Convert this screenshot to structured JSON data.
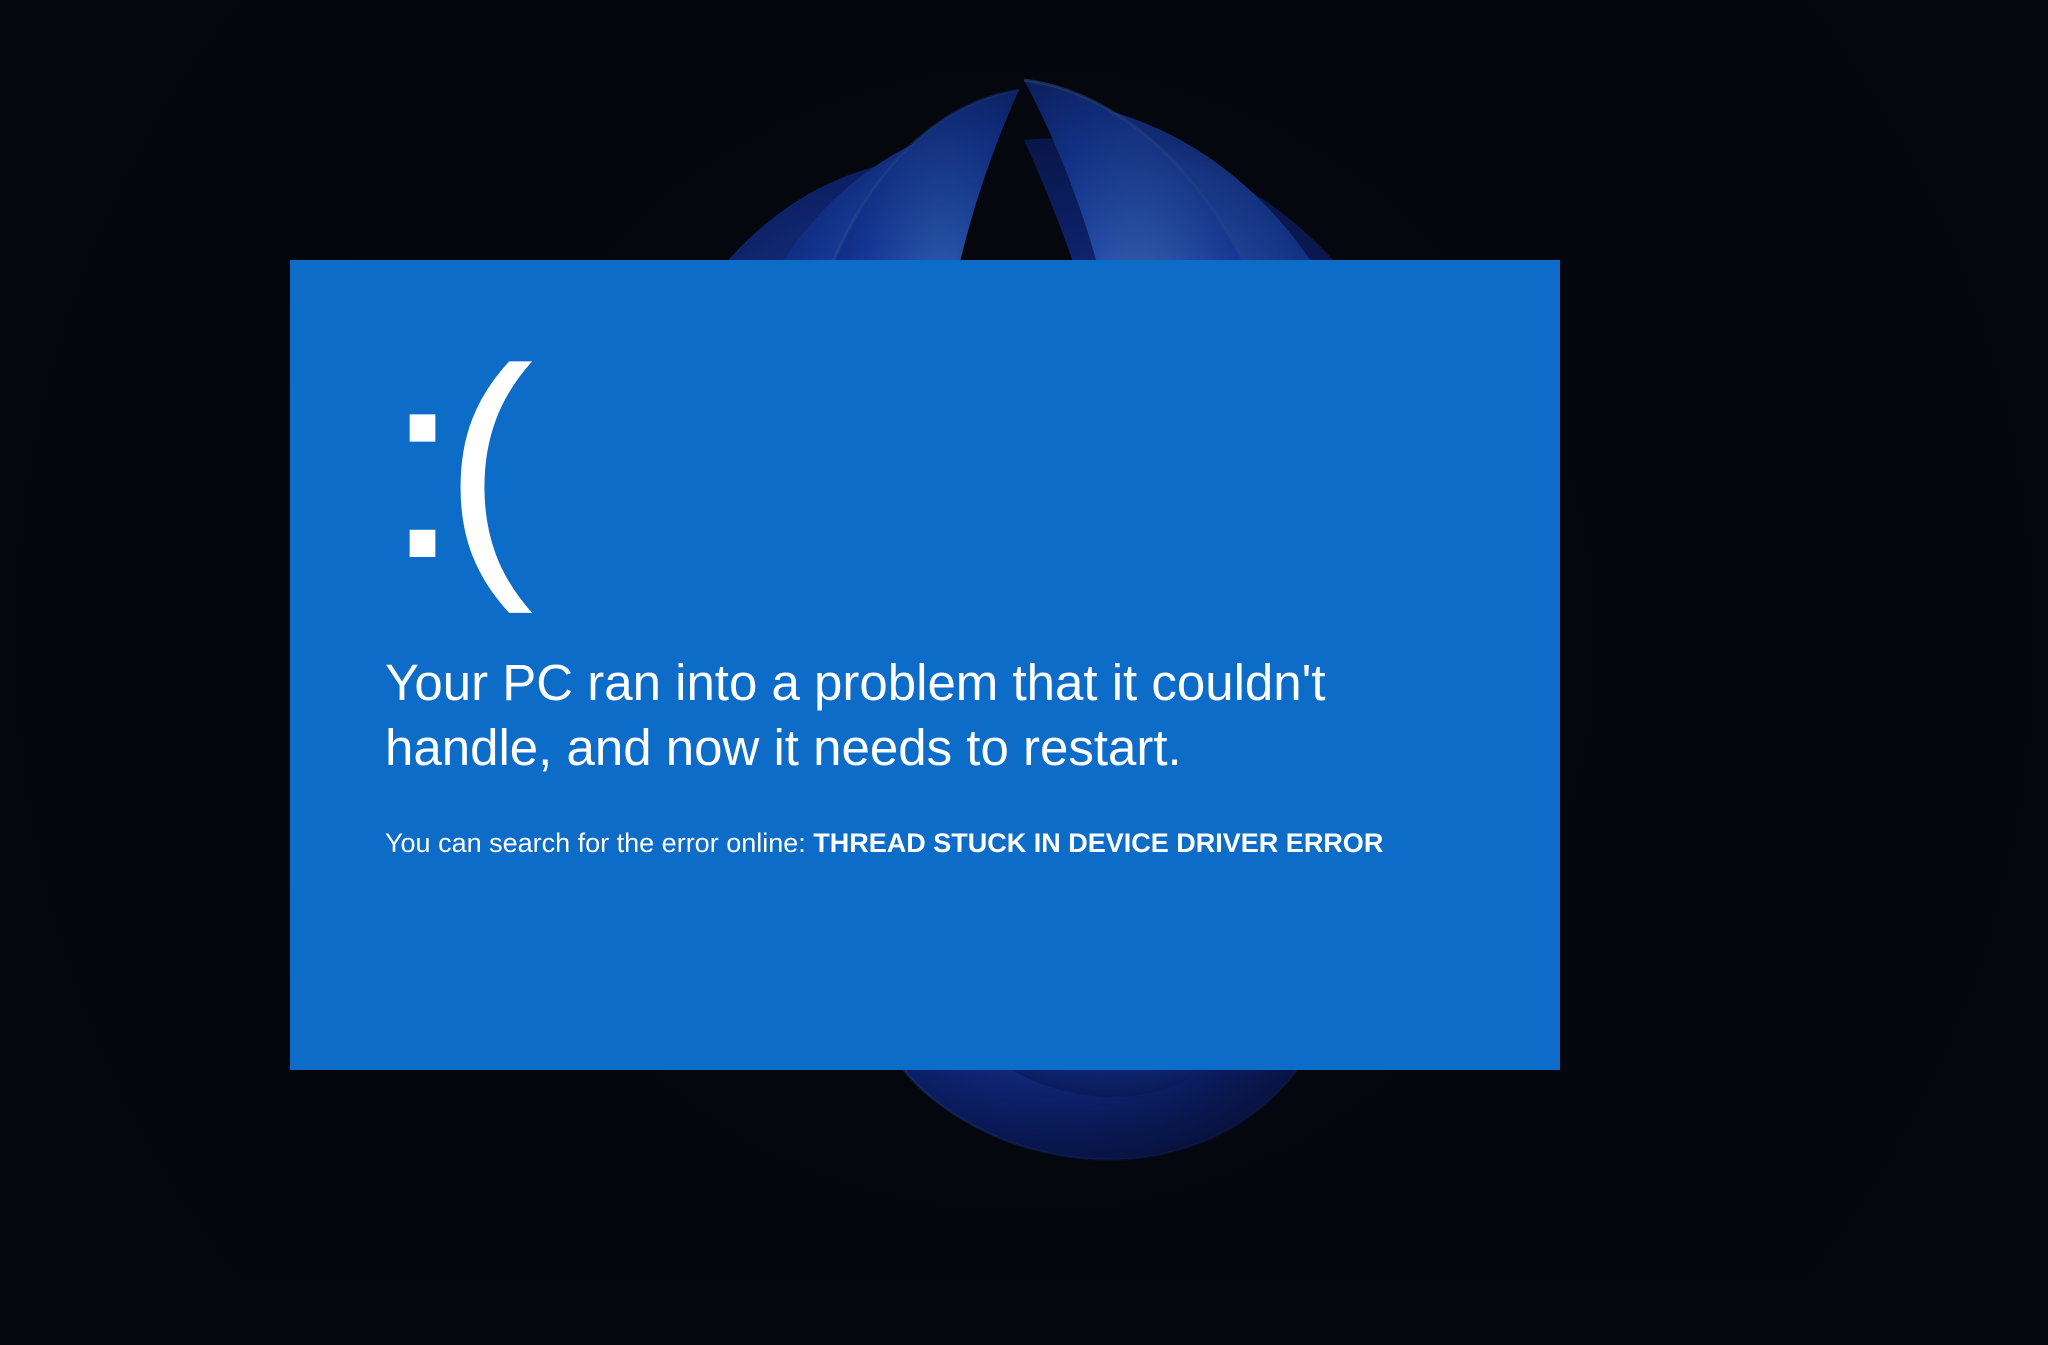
{
  "bsod": {
    "sad_face": ":(",
    "main_message": "Your PC ran into a problem that it couldn't handle, and now it needs to restart.",
    "search_prefix": "You can search for the error online: ",
    "error_code": "THREAD STUCK IN DEVICE DRIVER ERROR"
  },
  "colors": {
    "panel_bg": "#0c6cc8",
    "page_bg": "#06080f"
  }
}
